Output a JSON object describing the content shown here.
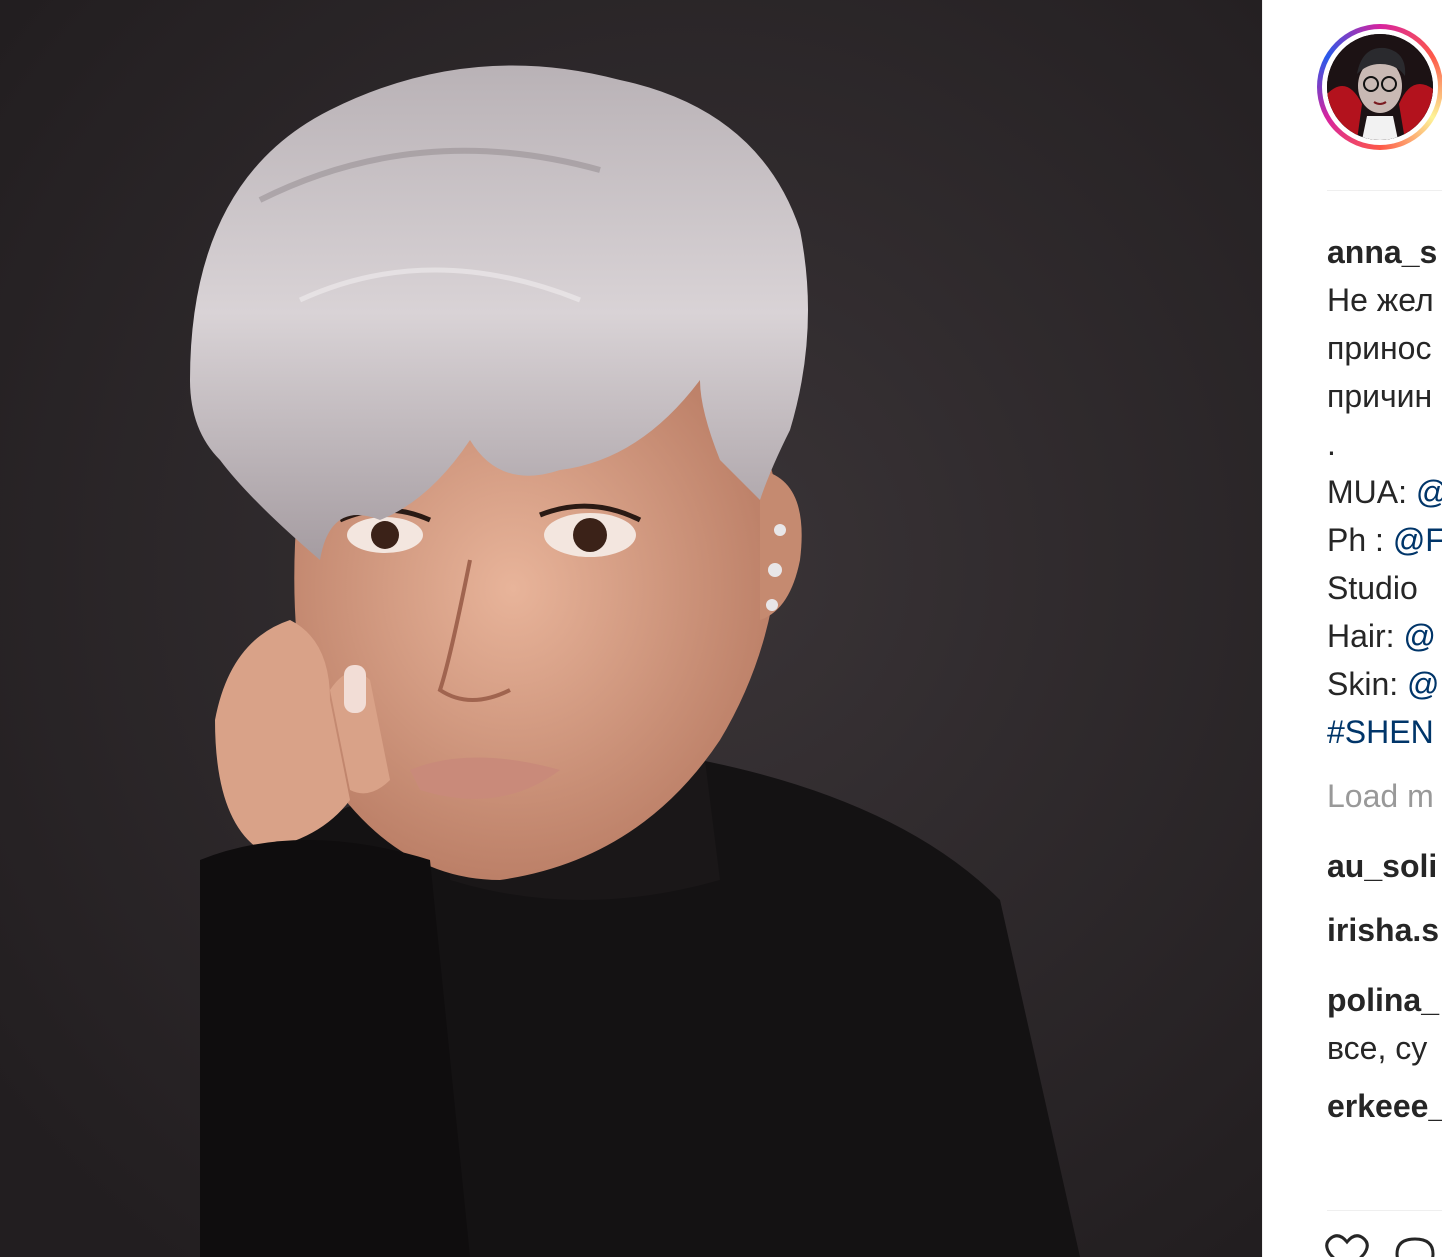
{
  "post": {
    "username": "anna_s",
    "caption_lines": [
      "Не жел",
      "принос",
      "причин",
      "."
    ],
    "credits": [
      {
        "label": "MUA: ",
        "handle": "@"
      },
      {
        "label": "Ph : ",
        "handle": "@F"
      },
      {
        "label": "Studio",
        "handle": ""
      },
      {
        "label": "Hair: ",
        "handle": "@"
      },
      {
        "label": "Skin: ",
        "handle": "@"
      }
    ],
    "hashtag": "#SHEN",
    "load_more": "Load m",
    "comments": [
      {
        "user": "au_soli",
        "text": ""
      },
      {
        "user": "irisha.s",
        "text": ""
      },
      {
        "user": "polina_",
        "text": "все, су"
      },
      {
        "user": "erkeee_",
        "text": ""
      }
    ]
  },
  "icons": {
    "heart": "heart-icon",
    "comment": "comment-icon",
    "avatar": "avatar"
  },
  "colors": {
    "photo_background": "#2a2628",
    "link": "#003569",
    "text": "#262626",
    "muted": "#999999",
    "ring_gradient": [
      "#d6249f",
      "#fd5949",
      "#fdf497",
      "#285AEB"
    ]
  }
}
